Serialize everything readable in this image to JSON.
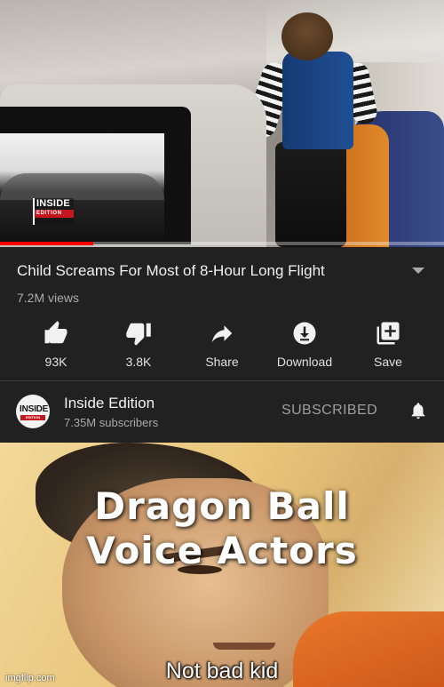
{
  "video": {
    "overlay_logo_top": "INSIDE",
    "overlay_logo_bottom": "EDITION",
    "progress_fraction": 0.21
  },
  "info": {
    "title": "Child Screams For Most of 8-Hour Long Flight",
    "views": "7.2M views",
    "actions": [
      {
        "icon": "thumbs-up-icon",
        "label": "93K"
      },
      {
        "icon": "thumbs-down-icon",
        "label": "3.8K"
      },
      {
        "icon": "share-icon",
        "label": "Share"
      },
      {
        "icon": "download-icon",
        "label": "Download"
      },
      {
        "icon": "save-playlist-icon",
        "label": "Save"
      }
    ]
  },
  "channel": {
    "avatar_top": "INSIDE",
    "avatar_bottom": "EDITION",
    "name": "Inside Edition",
    "subscribers": "7.35M subscribers",
    "subscribe_label": "SUBSCRIBED"
  },
  "meme": {
    "caption_line1": "Dragon Ball",
    "caption_line2": "Voice Actors",
    "subtitle": "Not bad kid",
    "watermark": "imgflip.com"
  },
  "colors": {
    "panel_bg": "#212121",
    "progress": "#ff0000",
    "text_secondary": "#aaaaaa"
  }
}
